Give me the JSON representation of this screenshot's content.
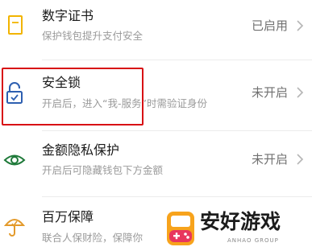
{
  "settings": [
    {
      "title": "数字证书",
      "subtitle": "保护钱包提升支付安全",
      "status": "已启用",
      "icon": "certificate-icon"
    },
    {
      "title": "安全锁",
      "subtitle": "开启后，进入“我-服务”时需验证身份",
      "status": "未开启",
      "icon": "lock-icon"
    },
    {
      "title": "金额隐私保护",
      "subtitle": "开启后可隐藏钱包下方金额",
      "status": "未开启",
      "icon": "eye-icon"
    },
    {
      "title": "百万保障",
      "subtitle": "联合人保财险，保障你"
    }
  ],
  "watermark": {
    "text": "安好游戏",
    "domain": "ANHAO GROUP"
  },
  "colors": {
    "highlight": "#d80f14",
    "icon_yellow": "#f2b400",
    "icon_blue": "#2d5fb0",
    "icon_green": "#1f7a3a",
    "icon_orange": "#e39a2b"
  }
}
